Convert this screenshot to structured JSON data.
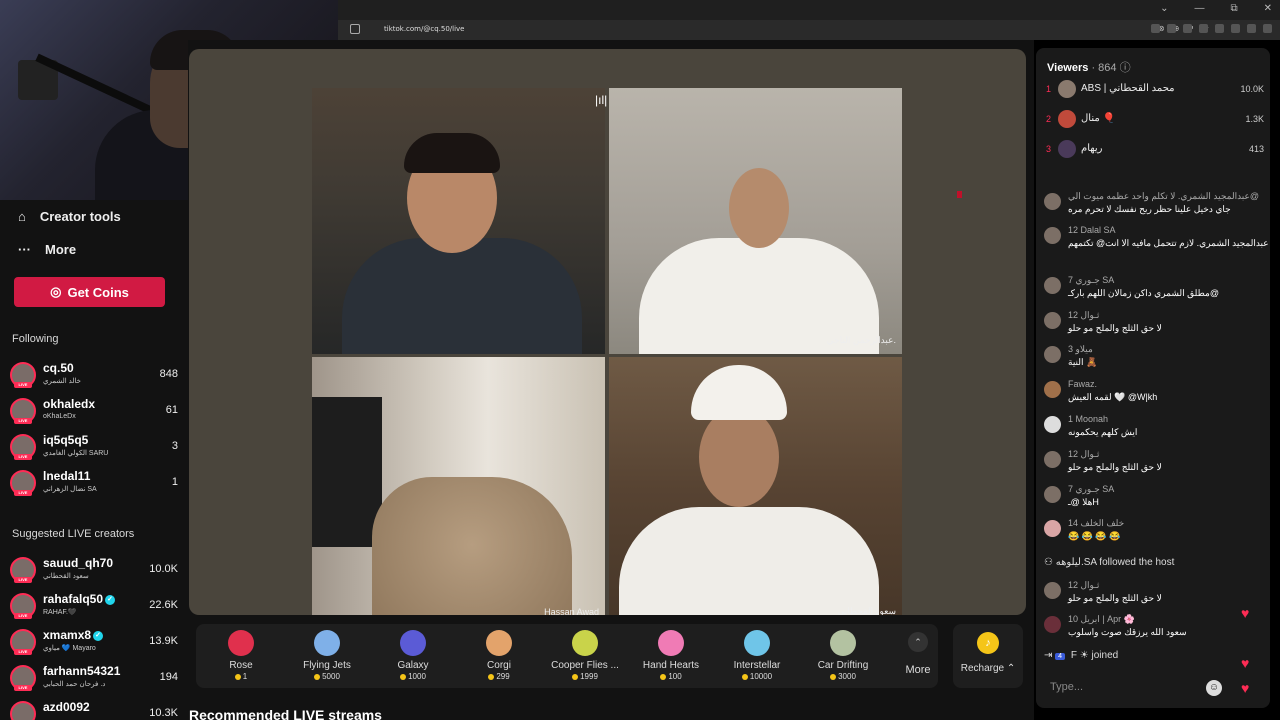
{
  "browser": {
    "url": "tiktok.com/@cq.50/live",
    "window_controls": [
      "⌄",
      "—",
      "⧉",
      "✕"
    ]
  },
  "sidebar": {
    "creator_tools": "Creator tools",
    "more": "More",
    "get_coins": "Get Coins",
    "following_title": "Following",
    "following": [
      {
        "name": "cq.50",
        "sub": "خالد الشمري",
        "count": "848"
      },
      {
        "name": "okhaledx",
        "sub": "oKhaLeDx",
        "count": "61"
      },
      {
        "name": "iq5q5q5",
        "sub": "الكولي الغامدي SARU",
        "count": "3"
      },
      {
        "name": "lnedal11",
        "sub": "نضال الزهراني SA",
        "count": "1"
      }
    ],
    "suggested_title": "Suggested LIVE creators",
    "suggested": [
      {
        "name": "sauud_qh70",
        "sub": "سعود القحطاني",
        "count": "10.0K",
        "verified": false
      },
      {
        "name": "rahafalq50",
        "sub": "RAHAF.🖤",
        "count": "22.6K",
        "verified": true
      },
      {
        "name": "xmamx8",
        "sub": "مياوي 💙 Mayaro",
        "count": "13.9K",
        "verified": true
      },
      {
        "name": "farhann54321",
        "sub": "د. فرحان حمد الحبابي",
        "count": "194",
        "verified": false
      },
      {
        "name": "azd0092",
        "sub": "",
        "count": "10.3K",
        "verified": false
      }
    ]
  },
  "stream": {
    "guest_labels": {
      "top_right": "عبدالرحمن الناجي.",
      "bottom_left": "Hassan Awad",
      "bottom_right": "سعود القحطاني"
    },
    "gifts": [
      {
        "name": "Rose",
        "price": "1",
        "color": "#e0304d"
      },
      {
        "name": "Flying Jets",
        "price": "5000",
        "color": "#7fb0e8"
      },
      {
        "name": "Galaxy",
        "price": "1000",
        "color": "#5b5bd6"
      },
      {
        "name": "Corgi",
        "price": "299",
        "color": "#e3a36b"
      },
      {
        "name": "Cooper Flies ...",
        "price": "1999",
        "color": "#c9d34a"
      },
      {
        "name": "Hand Hearts",
        "price": "100",
        "color": "#f07bb5"
      },
      {
        "name": "Interstellar",
        "price": "10000",
        "color": "#6fc5e8"
      },
      {
        "name": "Car Drifting",
        "price": "3000",
        "color": "#b3c2a1"
      }
    ],
    "more_label": "More",
    "recharge_label": "Recharge",
    "recommended_title": "Recommended LIVE streams"
  },
  "chat": {
    "viewers_label": "Viewers",
    "viewers_count": "· 864",
    "top_viewers": [
      {
        "rank": "1",
        "name": "ABS | محمد القحطاني",
        "value": "10.0K"
      },
      {
        "rank": "2",
        "name": "منال 🎈",
        "value": "1.3K"
      },
      {
        "rank": "3",
        "name": "ريهام",
        "value": "413"
      }
    ],
    "messages": [
      {
        "header": "عبدالمجيد الشمري. لا تكلم واحد عظمه ميوت الي@",
        "body": "جاي دخيل علينا حظر ريح نفسك لا تحرم مره"
      },
      {
        "header": "12  Dalal SA",
        "body": "عبدالمجيد الشمري. لازم تتحمل مافيه الا انت@ تكتمهم"
      },
      {
        "header": "7  جـوري SA",
        "body": "مطلق الشمري داكن زمالان اللهم باركـ@"
      },
      {
        "header": "12  ثـوال",
        "body": "لا حق الثلج والملح مو حلو"
      },
      {
        "header": "3  ميلاو",
        "body": "النية 🧸"
      },
      {
        "header": "Fawaz.",
        "body": "لقمه العيش 🤍 @W|kh"
      },
      {
        "header": "1  Moonah",
        "body": "ايش كلهم يحكمونه"
      },
      {
        "header": "12  ثـوال",
        "body": "لا حق الثلج والملح مو حلو"
      },
      {
        "header": "7  جـوري SA",
        "body": "هلا @ـH"
      },
      {
        "header": "14  خلف الخلف",
        "body": "😂 😂 😂 😂"
      }
    ],
    "followed": {
      "user": "ليلوهه.SA",
      "text": "followed the host"
    },
    "messages2": [
      {
        "header": "12  ثـوال",
        "body": "لا حق الثلج والملح مو حلو"
      },
      {
        "header": "10  ابريل | Apr 🌸",
        "body": "سعود الله يرزقك صوت واسلوب"
      }
    ],
    "joined": {
      "level": "4",
      "user": "F ☀",
      "text": "joined"
    },
    "input_placeholder": "Type..."
  }
}
